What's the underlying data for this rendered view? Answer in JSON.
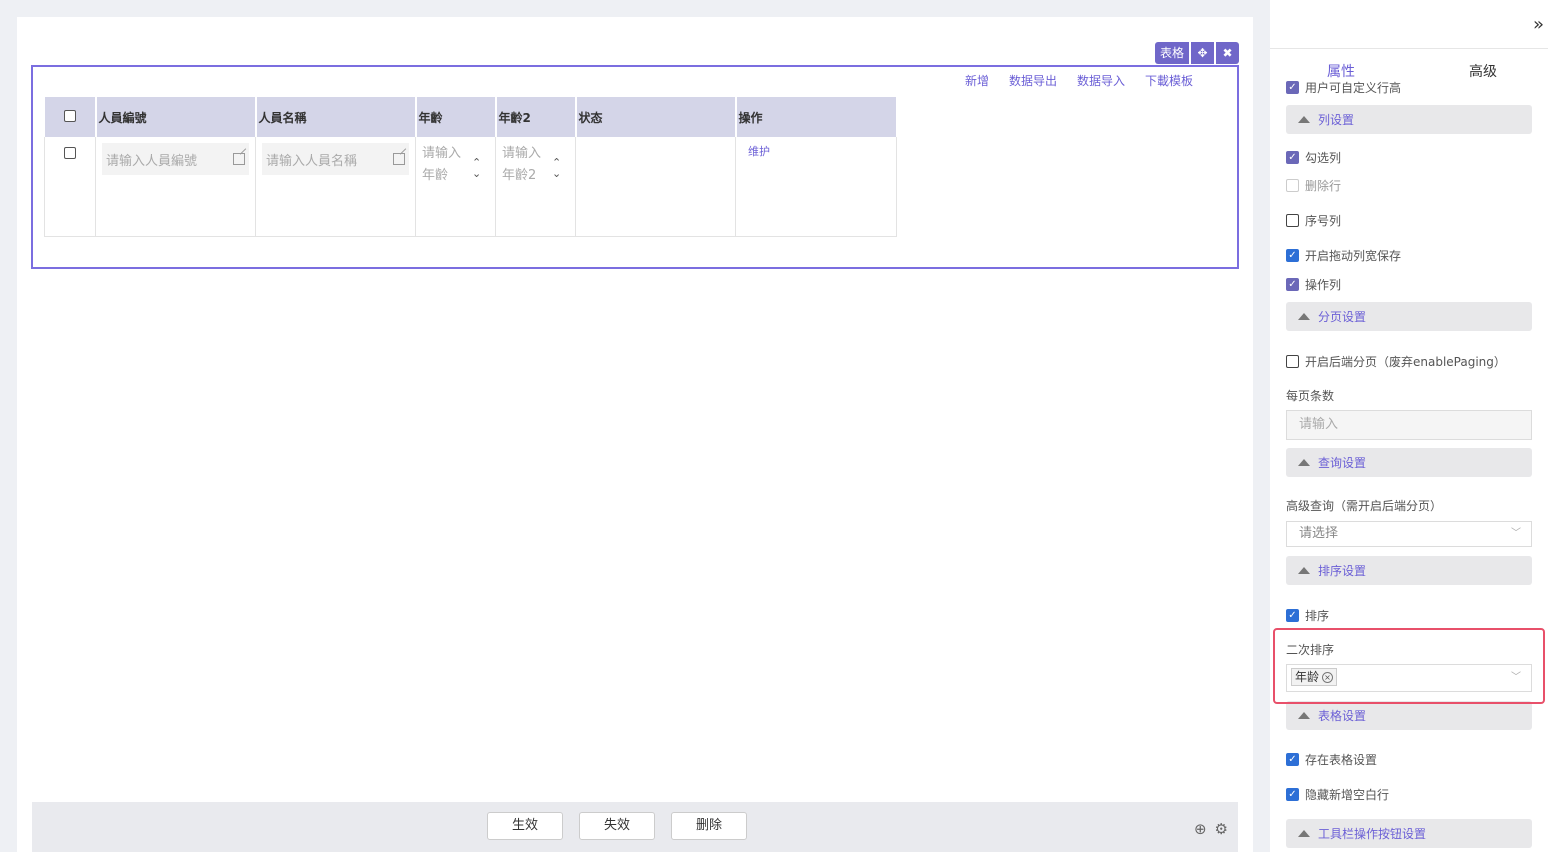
{
  "widget": {
    "tag_label": "表格",
    "move_icon": "move-icon",
    "close_icon": "close-icon",
    "links": [
      "新增",
      "数据导出",
      "数据导入",
      "下載模板"
    ]
  },
  "table": {
    "columns": [
      "人員編號",
      "人員名稱",
      "年齡",
      "年齡2",
      "状态",
      "操作"
    ],
    "row": {
      "code_placeholder": "请输入人員編號",
      "name_placeholder": "请输入人員名稱",
      "age_placeholder": "请输入年齡",
      "age2_placeholder": "请输入年齡2",
      "action": "维护"
    }
  },
  "footer": {
    "buttons": [
      "生效",
      "失效",
      "删除"
    ],
    "icons": [
      "add-circle-icon",
      "settings-icon"
    ]
  },
  "panel": {
    "collapse_icon": "double-chevron-right-icon",
    "tabs": [
      "属性",
      "高级"
    ],
    "items": {
      "custom_row_height": "用户可自定义行高",
      "column_settings": "列设置",
      "checkbox_column": "勾选列",
      "delete_row": "删除行",
      "index_column": "序号列",
      "drag_column_save": "开启拖动列宽保存",
      "action_column": "操作列",
      "paging_settings": "分页设置",
      "backend_paging": "开启后端分页（废弃enablePaging）",
      "page_size_label": "每页条数",
      "page_size_placeholder": "请输入",
      "query_settings": "查询设置",
      "advanced_query_label": "高级查询（需开启后端分页）",
      "advanced_query_placeholder": "请选择",
      "sort_settings": "排序设置",
      "sort": "排序",
      "secondary_sort_label": "二次排序",
      "secondary_sort_chip": "年龄",
      "table_settings": "表格设置",
      "save_table_settings": "存在表格设置",
      "hide_blank_row": "隐藏新增空白行",
      "toolbar_button_settings": "工具栏操作按钮设置"
    }
  }
}
